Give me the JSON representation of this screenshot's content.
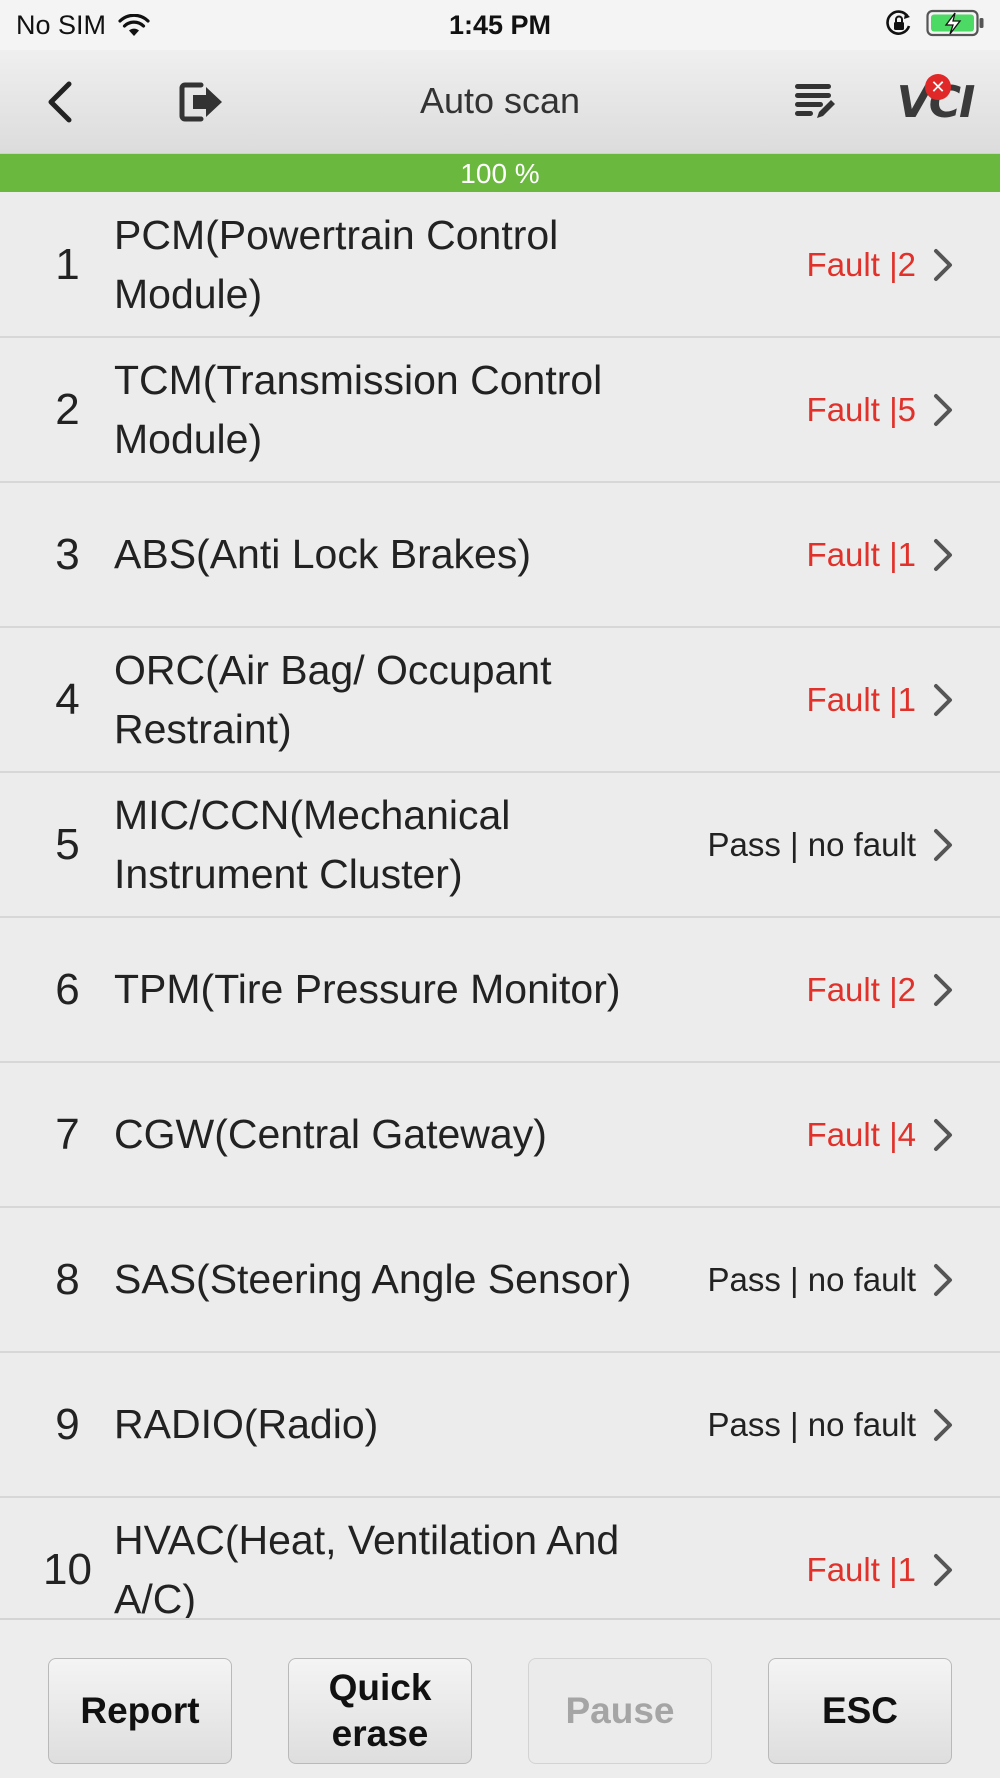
{
  "status_bar": {
    "carrier": "No SIM",
    "time": "1:45 PM"
  },
  "nav": {
    "title": "Auto scan",
    "vci_label": "VCI",
    "vci_badge": "✕"
  },
  "progress": {
    "label": "100 %",
    "value": 100
  },
  "colors": {
    "fault": "#e0312a",
    "progress": "#6ab83e"
  },
  "modules": [
    {
      "num": "1",
      "name": "PCM(Powertrain Control Module)",
      "status": "Fault |2",
      "state": "fault"
    },
    {
      "num": "2",
      "name": "TCM(Transmission Control Module)",
      "status": "Fault |5",
      "state": "fault"
    },
    {
      "num": "3",
      "name": "ABS(Anti Lock Brakes)",
      "status": "Fault |1",
      "state": "fault"
    },
    {
      "num": "4",
      "name": "ORC(Air Bag/ Occupant Restraint)",
      "status": "Fault |1",
      "state": "fault"
    },
    {
      "num": "5",
      "name": "MIC/CCN(Mechanical Instrument Cluster)",
      "status": "Pass | no fault",
      "state": "pass"
    },
    {
      "num": "6",
      "name": "TPM(Tire Pressure Monitor)",
      "status": "Fault |2",
      "state": "fault"
    },
    {
      "num": "7",
      "name": "CGW(Central Gateway)",
      "status": "Fault |4",
      "state": "fault"
    },
    {
      "num": "8",
      "name": "SAS(Steering Angle Sensor)",
      "status": "Pass | no fault",
      "state": "pass"
    },
    {
      "num": "9",
      "name": "RADIO(Radio)",
      "status": "Pass | no fault",
      "state": "pass"
    },
    {
      "num": "10",
      "name": "HVAC(Heat, Ventilation And A/C)",
      "status": "Fault |1",
      "state": "fault"
    }
  ],
  "toolbar": {
    "report": "Report",
    "quick_erase": "Quick erase",
    "pause": "Pause",
    "esc": "ESC"
  }
}
